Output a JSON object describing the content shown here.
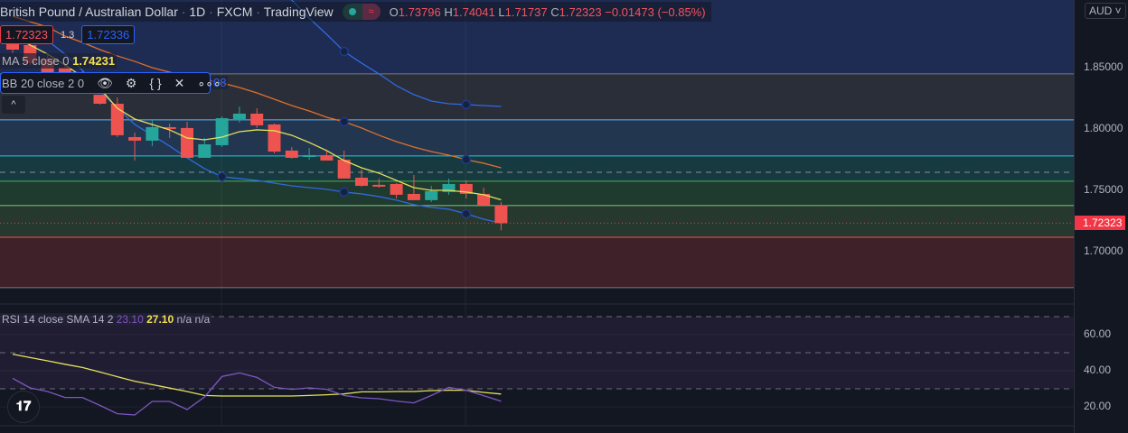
{
  "header": {
    "symbol": "British Pound / Australian Dollar",
    "interval": "1D",
    "exchange": "FXCM",
    "source": "TradingView",
    "dot": "·",
    "toggle_icon": "≈",
    "ohlc": {
      "o_label": "O",
      "o": "1.73796",
      "h_label": "H",
      "h": "1.74041",
      "l_label": "L",
      "l": "1.71737",
      "c_label": "C",
      "c": "1.72323",
      "change": "−0.01473 (−0.85%)"
    }
  },
  "trade": {
    "sell": "1.72323",
    "spread": "1.3",
    "buy": "1.72336"
  },
  "ma": {
    "label": "MA 5 close 0",
    "value": "1.74231"
  },
  "bb": {
    "label": "BB 20 close 2 0",
    "hidden_value": "08",
    "icons": [
      "eye-icon",
      "gear-icon",
      "braces-icon",
      "close-icon",
      "more-icon"
    ]
  },
  "collapse_label": "^",
  "rsi": {
    "label": "RSI 14 close SMA 14 2",
    "rsi_value": "23.10",
    "sma_value": "27.10",
    "na1": "n/a",
    "na2": "n/a"
  },
  "axis": {
    "currency": "AUD",
    "price_ticks": [
      "1.85000",
      "1.80000",
      "1.75000",
      "1.70000"
    ],
    "last_price": "1.72323",
    "rsi_ticks": [
      "60.00",
      "40.00",
      "20.00"
    ]
  },
  "logo": "TV",
  "colors": {
    "up": "#26a69a",
    "down": "#ef5350",
    "ma": "#e6e15a",
    "bb_basis": "#e0702a",
    "bb_band": "#2f6ae0",
    "rsi": "#7e57c2",
    "rsi_sma": "#e6e15a"
  },
  "chart_data": {
    "type": "candlestick",
    "price_range": [
      1.665,
      1.905
    ],
    "candles": [
      [
        1.872,
        1.876,
        1.862,
        1.8647
      ],
      [
        1.8684,
        1.87,
        1.852,
        1.8537
      ],
      [
        1.8574,
        1.86,
        1.844,
        1.8463
      ],
      [
        1.85,
        1.852,
        1.84,
        1.8412
      ],
      [
        1.8449,
        1.847,
        1.833,
        1.8346
      ],
      [
        1.8279,
        1.8316,
        1.8199,
        1.8206
      ],
      [
        1.8206,
        1.8257,
        1.7934,
        1.7949
      ],
      [
        1.7934,
        1.7971,
        1.7743,
        1.7905
      ],
      [
        1.7905,
        1.8074,
        1.7861,
        1.8015
      ],
      [
        1.8015,
        1.8044,
        1.7927,
        1.8
      ],
      [
        1.8008,
        1.8059,
        1.7765,
        1.7765
      ],
      [
        1.7765,
        1.7927,
        1.7765,
        1.7875
      ],
      [
        1.7868,
        1.8103,
        1.7853,
        1.8088
      ],
      [
        1.8081,
        1.8184,
        1.8052,
        1.8125
      ],
      [
        1.8125,
        1.8169,
        1.8008,
        1.803
      ],
      [
        1.8037,
        1.8044,
        1.7802,
        1.7816
      ],
      [
        1.7824,
        1.7853,
        1.7758,
        1.7765
      ],
      [
        1.7772,
        1.7846,
        1.775,
        1.7787
      ],
      [
        1.7787,
        1.7824,
        1.7743,
        1.7743
      ],
      [
        1.775,
        1.7824,
        1.7596,
        1.7596
      ],
      [
        1.7603,
        1.767,
        1.753,
        1.7537
      ],
      [
        1.7545,
        1.7596,
        1.7522,
        1.753
      ],
      [
        1.7552,
        1.7559,
        1.7434,
        1.7464
      ],
      [
        1.7471,
        1.7625,
        1.742,
        1.742
      ],
      [
        1.742,
        1.7537,
        1.7405,
        1.7493
      ],
      [
        1.7486,
        1.7596,
        1.7464,
        1.7552
      ],
      [
        1.7552,
        1.7581,
        1.7434,
        1.7471
      ],
      [
        1.7471,
        1.7522,
        1.7376,
        1.7376
      ],
      [
        1.73796,
        1.74041,
        1.71737,
        1.72323
      ]
    ],
    "ma5": [
      1.8757,
      1.8684,
      1.861,
      1.8522,
      1.8426,
      1.8331,
      1.8169,
      1.8081,
      1.8037,
      1.7993,
      1.7927,
      1.7912,
      1.7934,
      1.7978,
      1.7993,
      1.7986,
      1.7949,
      1.789,
      1.7824,
      1.7743,
      1.7684,
      1.764,
      1.7581,
      1.7522,
      1.75,
      1.75,
      1.7486,
      1.7464,
      1.74231
    ],
    "bb_basis": [
      1.8919,
      1.8875,
      1.8831,
      1.8757,
      1.8706,
      1.8647,
      1.8596,
      1.8551,
      1.85,
      1.8463,
      1.8427,
      1.8404,
      1.8375,
      1.8338,
      1.8294,
      1.8243,
      1.8191,
      1.8147,
      1.8096,
      1.8059,
      1.8008,
      1.7949,
      1.7897,
      1.7853,
      1.7816,
      1.7787,
      1.775,
      1.7721,
      1.7684
    ],
    "bb_upper": [
      null,
      null,
      null,
      null,
      null,
      null,
      null,
      null,
      null,
      null,
      null,
      null,
      null,
      null,
      null,
      1.9125,
      1.9051,
      1.8904,
      1.8772,
      1.8632,
      1.8537,
      1.8449,
      1.8353,
      1.828,
      1.8228,
      1.8206,
      1.8199,
      1.8191,
      1.8184
    ],
    "bb_lower": [
      null,
      1.8831,
      1.8721,
      1.861,
      1.8478,
      1.8316,
      1.8169,
      1.8037,
      1.7949,
      1.7861,
      1.7765,
      1.7677,
      1.7611,
      1.7596,
      1.7581,
      1.7559,
      1.7537,
      1.7522,
      1.7508,
      1.7486,
      1.7471,
      1.7449,
      1.742,
      1.7383,
      1.7361,
      1.7346,
      1.7309,
      1.7265,
      1.72336
    ],
    "levels": [
      {
        "price": 1.8449,
        "color": "#787b86",
        "fill": "#1e2b52"
      },
      {
        "price": 1.8074,
        "color": "#64b5f6",
        "fill": "#2a2e39"
      },
      {
        "price": 1.778,
        "color": "#26c6da",
        "fill": "#223650"
      },
      {
        "price": 1.7574,
        "color": "#4caf50",
        "fill": "#163a40"
      },
      {
        "price": 1.7376,
        "color": "#81c784",
        "fill": "#1f3a2f"
      },
      {
        "price": 1.7118,
        "color": "#ef5350",
        "fill": "#27392f"
      },
      {
        "price": 1.6707,
        "color": "#787b86",
        "fill": "#3f2129"
      }
    ],
    "dashed_level": 1.7647,
    "rsi": [
      35.8,
      30.5,
      28.5,
      25.2,
      25.2,
      20.8,
      16.2,
      15.5,
      23,
      23,
      18.5,
      25.5,
      36.8,
      38.8,
      36.3,
      30.8,
      29.7,
      30.5,
      29.7,
      26.3,
      25,
      24.5,
      23.2,
      22.2,
      26.3,
      30.8,
      29.2,
      26.2,
      23.1
    ],
    "rsi_sma": [
      49.2,
      47.3,
      45.5,
      43.6,
      41.8,
      39.3,
      36.7,
      34.2,
      32.3,
      30.4,
      28.5,
      26.3,
      26,
      26,
      26,
      26,
      26,
      26.3,
      26.7,
      27.2,
      28.3,
      28.3,
      28.5,
      28.5,
      29,
      29.2,
      29.2,
      28,
      27.1
    ],
    "rsi_range": [
      10,
      80
    ],
    "rsi_bands": [
      70,
      50,
      30
    ]
  }
}
